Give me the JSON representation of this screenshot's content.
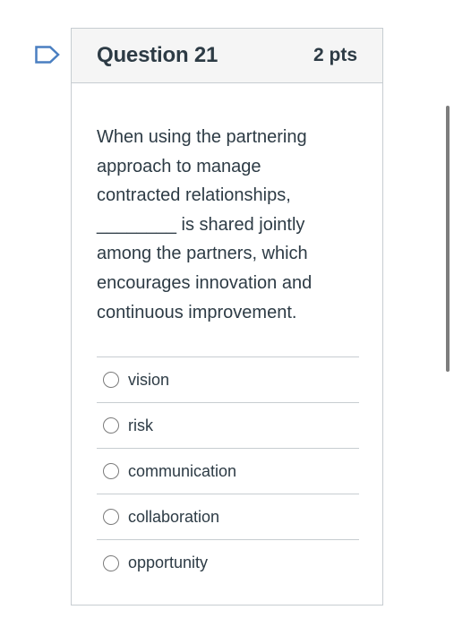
{
  "question": {
    "title": "Question 21",
    "points": "2 pts",
    "text": "When using the partnering approach to manage contracted relationships, ________ is shared jointly among the partners, which encourages innovation and continuous improvement.",
    "flag_icon": "flag-outline-icon"
  },
  "answers": [
    {
      "label": "vision",
      "selected": false
    },
    {
      "label": "risk",
      "selected": false
    },
    {
      "label": "communication",
      "selected": false
    },
    {
      "label": "collaboration",
      "selected": false
    },
    {
      "label": "opportunity",
      "selected": false
    }
  ],
  "colors": {
    "text": "#2d3b45",
    "border": "#c7cdd1",
    "header_bg": "#f5f5f5",
    "flag": "#4a7fc1",
    "scrollbar": "#7d7d7d"
  }
}
